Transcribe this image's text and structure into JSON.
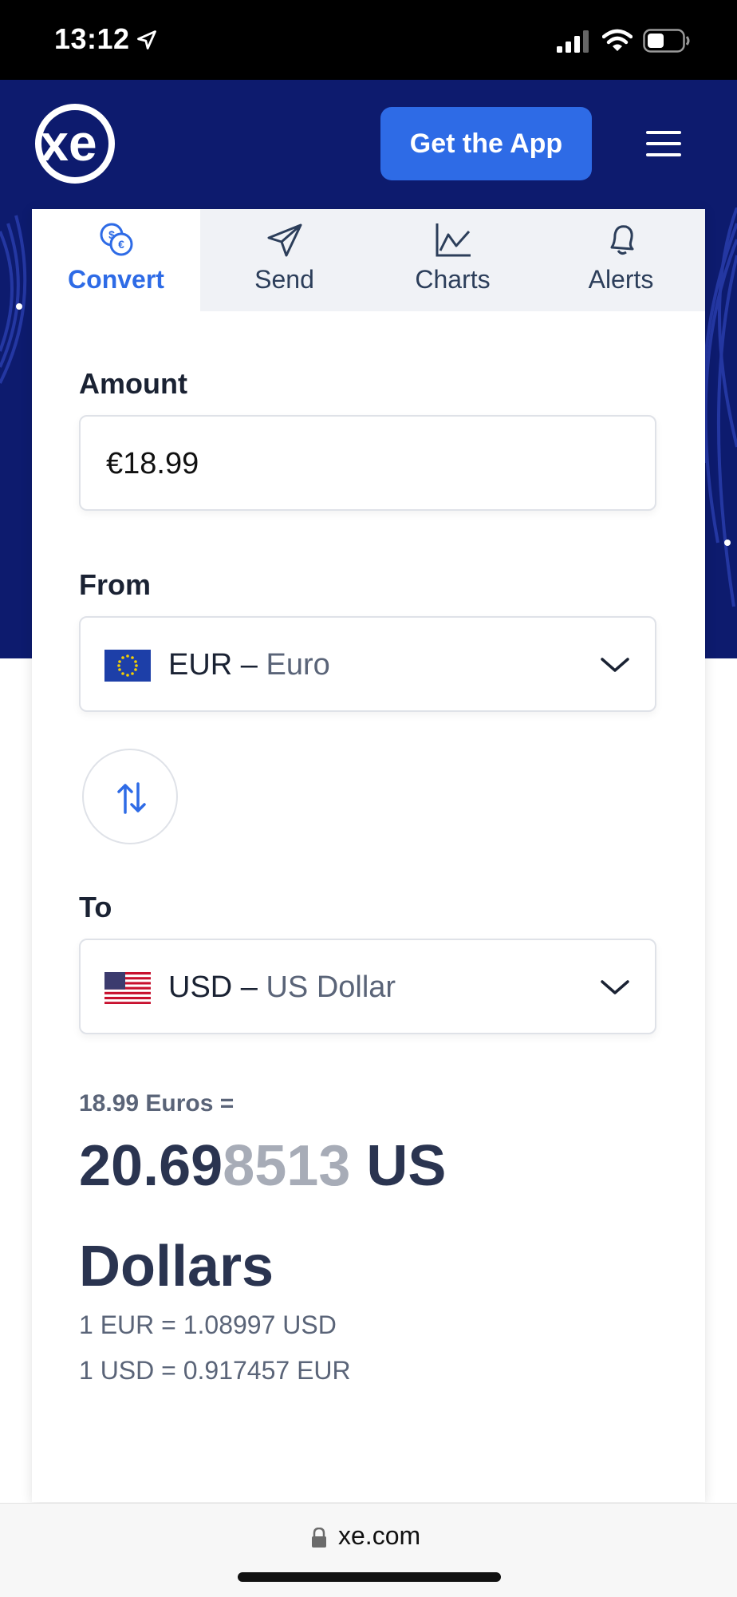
{
  "status_bar": {
    "time": "13:12"
  },
  "header": {
    "logo_text": "xe",
    "get_app_label": "Get the App"
  },
  "tabs": [
    {
      "label": "Convert",
      "icon": "coins-icon",
      "active": true
    },
    {
      "label": "Send",
      "icon": "paper-plane-icon",
      "active": false
    },
    {
      "label": "Charts",
      "icon": "line-chart-icon",
      "active": false
    },
    {
      "label": "Alerts",
      "icon": "bell-icon",
      "active": false
    }
  ],
  "converter": {
    "amount_label": "Amount",
    "amount_value": "€18.99",
    "from_label": "From",
    "from_code": "EUR –",
    "from_name": "Euro",
    "to_label": "To",
    "to_code": "USD –",
    "to_name": "US Dollar"
  },
  "result": {
    "from_text": "18.99 Euros =",
    "value_main": "20.69",
    "value_faded": "8513",
    "unit": "US Dollars",
    "rate_1": "1 EUR = 1.08997 USD",
    "rate_2": "1 USD = 0.917457 EUR"
  },
  "browser": {
    "url": "xe.com"
  },
  "colors": {
    "header_bg": "#0d1b6e",
    "accent": "#2e6be6"
  }
}
